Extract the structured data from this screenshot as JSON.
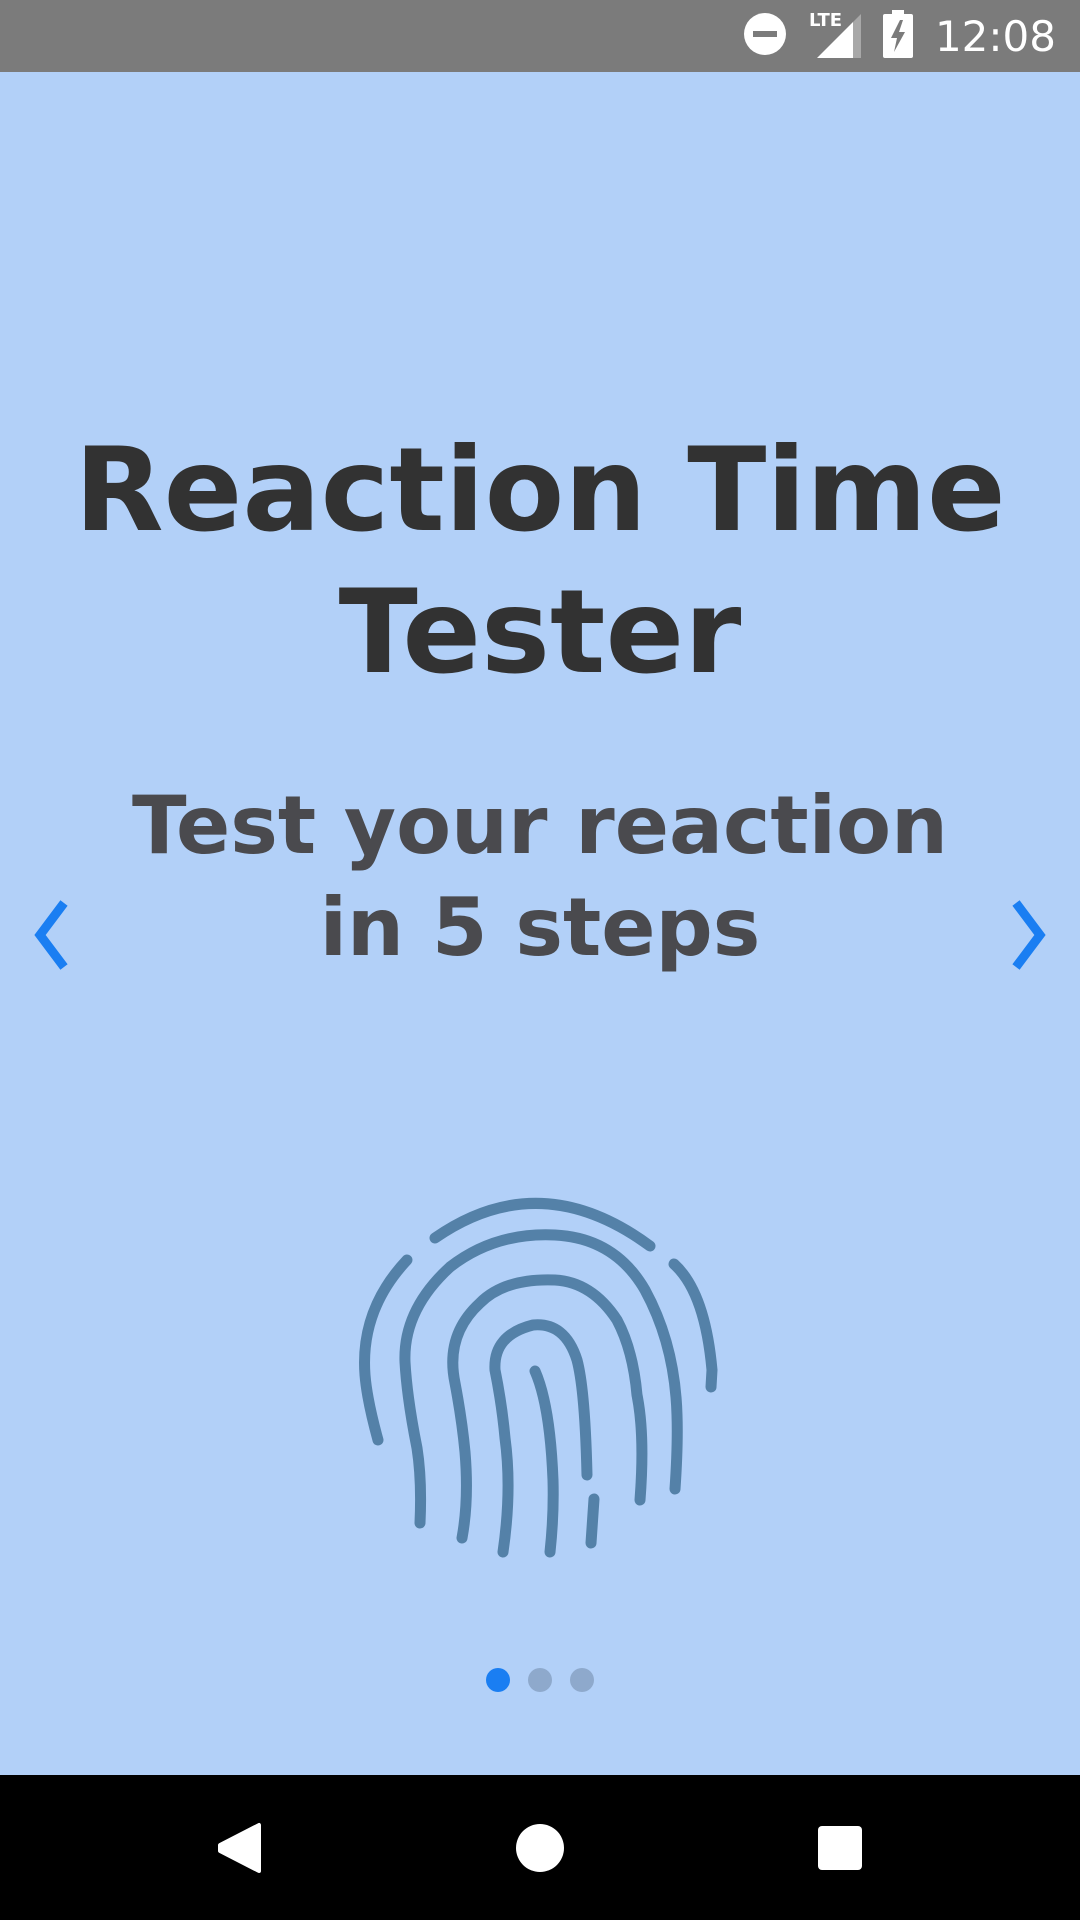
{
  "status_bar": {
    "time": "12:08",
    "network_label": "LTE",
    "icons": [
      "do-not-disturb-icon",
      "signal-icon",
      "battery-charging-icon"
    ]
  },
  "onboarding": {
    "title_line1": "Reaction Time",
    "title_line2": "Tester",
    "subtitle_line1": "Test your reaction",
    "subtitle_line2": "in 5 steps",
    "prev_icon": "chevron-left-icon",
    "next_icon": "chevron-right-icon",
    "illustration_icon": "fingerprint-icon",
    "page_count": 3,
    "current_page": 1
  },
  "nav_bar": {
    "icons": [
      "back-icon",
      "home-icon",
      "recents-icon"
    ]
  },
  "colors": {
    "background": "#b2d0f8",
    "status_bar": "#7b7b7b",
    "title_text": "#323232",
    "subtitle_text": "#4a4a4e",
    "accent": "#1a7ef2",
    "fingerprint": "#5481a8",
    "dot_inactive": "#8ea9cc",
    "nav_bar": "#000000"
  }
}
